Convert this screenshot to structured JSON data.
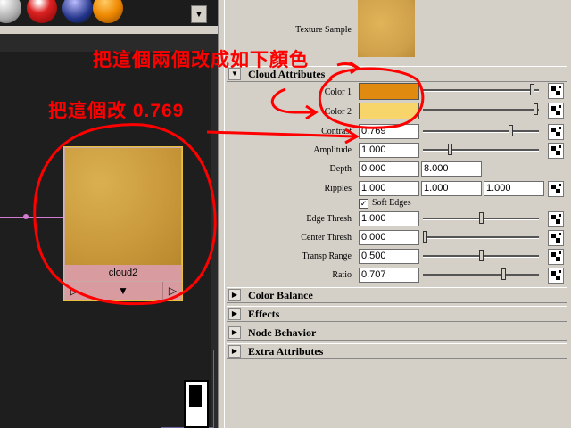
{
  "texture_sample": {
    "label": "Texture Sample",
    "color": "#cfa04a"
  },
  "sections": {
    "cloud_attributes": "Cloud Attributes",
    "color_balance": "Color Balance",
    "effects": "Effects",
    "node_behavior": "Node Behavior",
    "extra_attributes": "Extra Attributes"
  },
  "attributes": {
    "color1": {
      "label": "Color 1",
      "color": "#e08a10",
      "slider": 0.96
    },
    "color2": {
      "label": "Color 2",
      "color": "#f8d56a",
      "slider": 0.99
    },
    "contrast": {
      "label": "Contrast",
      "value": "0.769",
      "slider": 0.769
    },
    "amplitude": {
      "label": "Amplitude",
      "value": "1.000",
      "slider": 0.22
    },
    "depth": {
      "label": "Depth",
      "values": [
        "0.000",
        "8.000"
      ]
    },
    "ripples": {
      "label": "Ripples",
      "values": [
        "1.000",
        "1.000",
        "1.000"
      ]
    },
    "soft_edges": {
      "label": "Soft Edges",
      "checked": true
    },
    "edge_thresh": {
      "label": "Edge Thresh",
      "value": "1.000",
      "slider": 0.5
    },
    "center_thresh": {
      "label": "Center Thresh",
      "value": "0.000",
      "slider": 0.0
    },
    "transp_range": {
      "label": "Transp Range",
      "value": "0.500",
      "slider": 0.5
    },
    "ratio": {
      "label": "Ratio",
      "value": "0.707",
      "slider": 0.707
    }
  },
  "node": {
    "name": "cloud2",
    "btn_left": "▷",
    "btn_mid": "▼",
    "btn_right": "▷"
  },
  "strip_scroll": "▼",
  "annotations": {
    "top_text": "把這個兩個改成如下顏色",
    "mid_text": "把這個改 0.769"
  },
  "colors": {
    "annotation": "#ff0000",
    "node_border": "#e8c040",
    "connection": "#d37bd3"
  }
}
